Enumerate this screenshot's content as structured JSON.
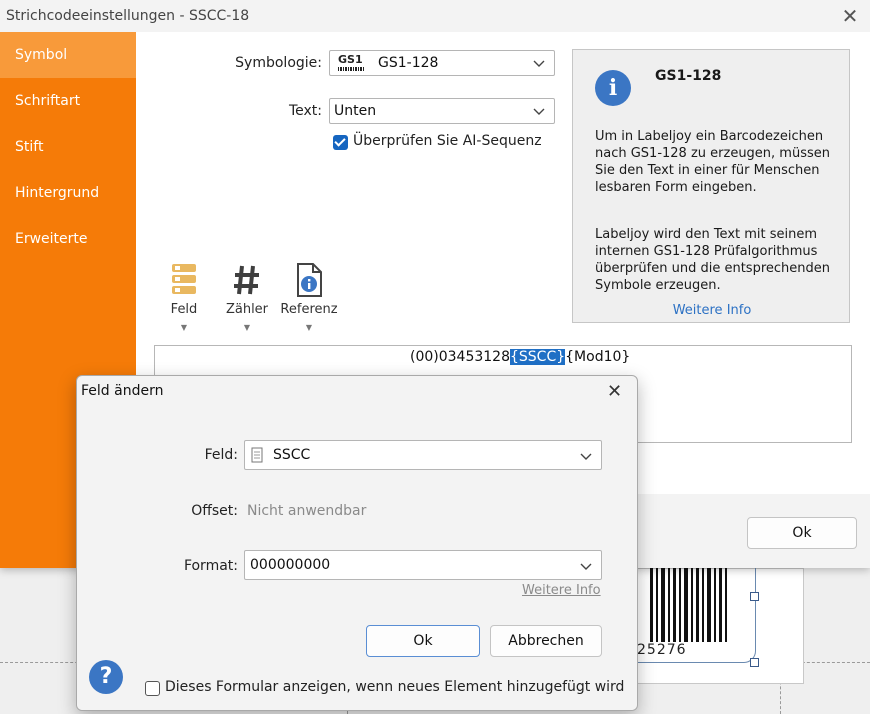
{
  "window": {
    "title": "Strichcodeeinstellungen - SSCC-18"
  },
  "sidebar": {
    "items": [
      {
        "label": "Symbol"
      },
      {
        "label": "Schriftart"
      },
      {
        "label": "Stift"
      },
      {
        "label": "Hintergrund"
      },
      {
        "label": "Erweiterte"
      }
    ]
  },
  "symbol": {
    "symbology_label": "Symbologie:",
    "gs1_logo_text": "GS1",
    "symbology_value": "GS1-128",
    "text_label": "Text:",
    "text_value": "Unten",
    "verify_label": "Überprüfen Sie AI-Sequenz"
  },
  "info": {
    "title": "GS1-128",
    "para1": "Um in Labeljoy ein Barcodezeichen nach GS1-128 zu erzeugen, müssen Sie den Text in einer für Menschen lesbaren Form eingeben.",
    "para2": "Labeljoy wird den Text mit seinem internen GS1-128 Prüfalgorithmus überprüfen und die entsprechenden Symbole erzeugen.",
    "link": "Weitere Info"
  },
  "toolbar": {
    "items": [
      {
        "label": "Feld"
      },
      {
        "label": "Zähler"
      },
      {
        "label": "Referenz"
      }
    ]
  },
  "textbox": {
    "pre": "(00)03453128",
    "selected": "{SSCC}",
    "post": "{Mod10}"
  },
  "footer": {
    "ok": "Ok"
  },
  "preview": {
    "barcode_number": "25276"
  },
  "dialog": {
    "title": "Feld ändern",
    "field_label": "Feld:",
    "field_value": "SSCC",
    "offset_label": "Offset:",
    "offset_value": "Nicht anwendbar",
    "format_label": "Format:",
    "format_value": "000000000",
    "more_info": "Weitere Info",
    "ok": "Ok",
    "cancel": "Abbrechen",
    "show_form_label": "Dieses Formular anzeigen, wenn neues Element hinzugefügt wird",
    "help_glyph": "?"
  },
  "colors": {
    "accent_orange": "#f57b08",
    "sidebar_active": "#f89a3a",
    "link_blue": "#2c71c4",
    "selection_blue": "#1f6fc5",
    "info_icon": "#3b76c4"
  },
  "icons": [
    "close-icon",
    "chevron-down-icon",
    "info-icon",
    "field-icon",
    "counter-icon",
    "reference-icon",
    "help-icon",
    "document-icon"
  ]
}
